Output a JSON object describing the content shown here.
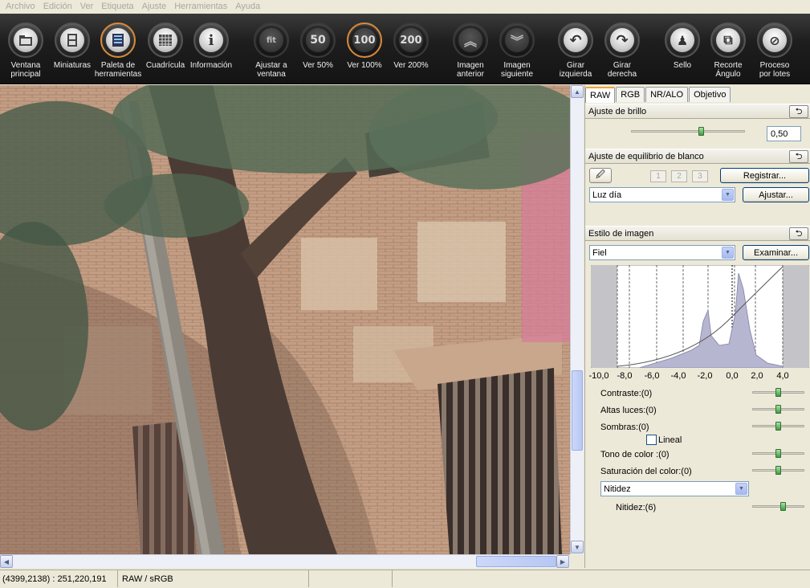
{
  "menu": [
    "Archivo",
    "Edición",
    "Ver",
    "Etiqueta",
    "Ajuste",
    "Herramientas",
    "Ayuda"
  ],
  "toolbar": {
    "buttons": [
      {
        "label": "Ventana\nprincipal",
        "icon": "folder-window-icon"
      },
      {
        "label": "Miniaturas",
        "icon": "thumbnails-icon"
      },
      {
        "label": "Paleta de\nherramientas",
        "icon": "tool-palette-icon"
      },
      {
        "label": "Cuadrícula",
        "icon": "grid-icon"
      },
      {
        "label": "Información",
        "icon": "info-icon",
        "glyph": "i"
      },
      {
        "label": "Ajustar a\nventana",
        "icon": "fit-window-icon",
        "glyph": "fit"
      },
      {
        "label": "Ver 50%",
        "icon": "zoom-50-icon",
        "glyph": "50"
      },
      {
        "label": "Ver 100%",
        "icon": "zoom-100-icon",
        "glyph": "100"
      },
      {
        "label": "Ver 200%",
        "icon": "zoom-200-icon",
        "glyph": "200"
      },
      {
        "label": "Imagen\nanterior",
        "icon": "previous-image-icon",
        "glyph": "︽"
      },
      {
        "label": "Imagen\nsiguiente",
        "icon": "next-image-icon",
        "glyph": "︾"
      },
      {
        "label": "Girar izquierda",
        "icon": "rotate-left-icon",
        "glyph": "↶"
      },
      {
        "label": "Girar derecha",
        "icon": "rotate-right-icon",
        "glyph": "↷"
      },
      {
        "label": "Sello",
        "icon": "stamp-icon",
        "glyph": "♟"
      },
      {
        "label": "Recorte\nÁngulo",
        "icon": "crop-angle-icon",
        "glyph": "⧉"
      },
      {
        "label": "Proceso\npor lotes",
        "icon": "batch-process-icon",
        "glyph": "⊘"
      }
    ]
  },
  "panel": {
    "tabs": [
      "RAW",
      "RGB",
      "NR/ALO",
      "Objetivo"
    ],
    "active_tab": "RAW",
    "brightness": {
      "title": "Ajuste de brillo",
      "value": "0,50",
      "slider_fraction": 0.62
    },
    "white_balance": {
      "title": "Ajuste de equilibrio de blanco",
      "presets": [
        "1",
        "2",
        "3"
      ],
      "register_label": "Registrar...",
      "preset_value": "Luz día",
      "adjust_label": "Ajustar..."
    },
    "picture_style": {
      "title": "Estilo de imagen",
      "value": "Fiel",
      "browse_label": "Examinar..."
    },
    "histogram_axis": [
      "-10,0",
      "-8,0",
      "-6,0",
      "-4,0",
      "-2,0",
      "0,0",
      "2,0",
      "4,0"
    ],
    "adjustments": [
      {
        "label": "Contraste:(0)",
        "fraction": 0.5
      },
      {
        "label": "Altas luces:(0)",
        "fraction": 0.5
      },
      {
        "label": "Sombras:(0)",
        "fraction": 0.5
      },
      {
        "label": "Tono de color :(0)",
        "fraction": 0.5
      },
      {
        "label": "Saturación del color:(0)",
        "fraction": 0.5
      }
    ],
    "linear_label": "Lineal",
    "sharpness_mode": "Nitidez",
    "sharpness": {
      "label": "Nitidez:(6)",
      "fraction": 0.6
    }
  },
  "status": {
    "coords": "(4399,2138) : 251,220,191",
    "mode": "RAW / sRGB"
  },
  "colors": {
    "accent_tab": "#f1a53a",
    "toolbar_bg": "#1e1e1e",
    "slider_knob": "#3ea03e"
  }
}
